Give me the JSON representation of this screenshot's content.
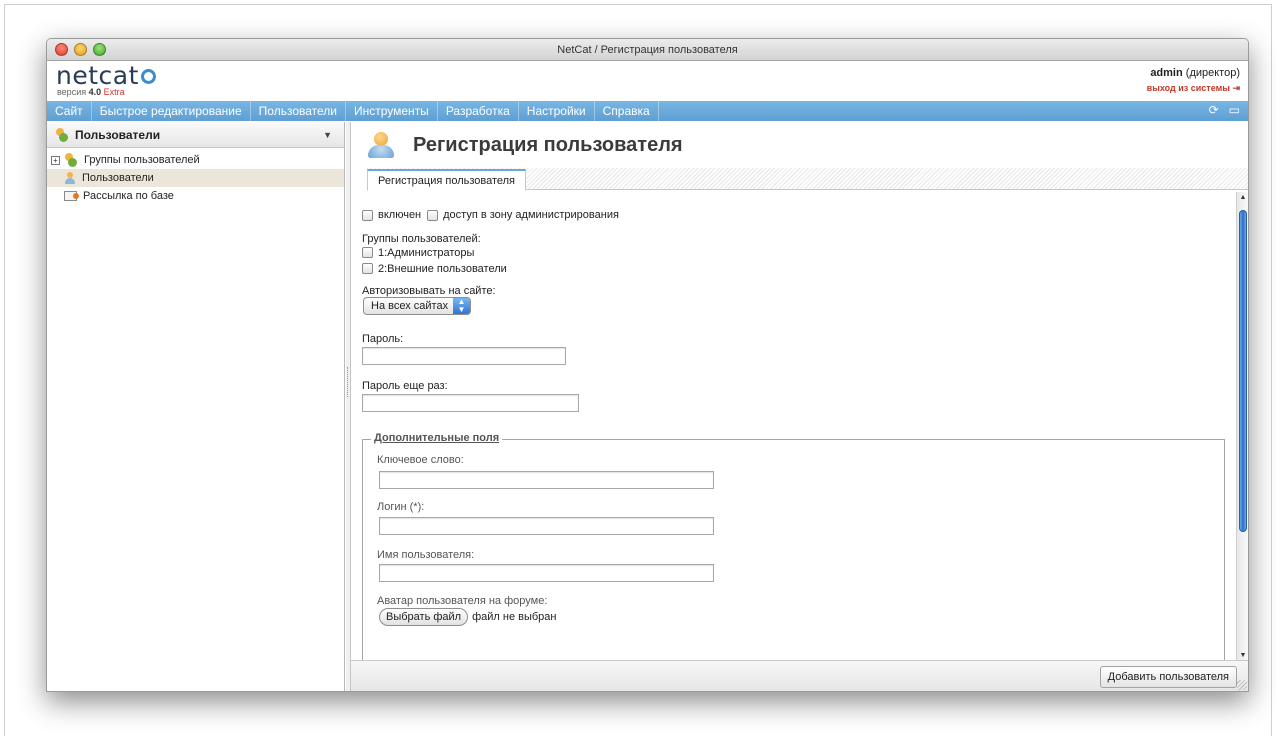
{
  "window": {
    "title": "NetCat / Регистрация пользователя"
  },
  "header": {
    "logo_text": "netcat",
    "version_prefix": "версия",
    "version_number": "4.0",
    "version_edition": "Extra",
    "user_name": "admin",
    "user_role": "(директор)",
    "logout_label": "выход из системы"
  },
  "menu": {
    "items": [
      "Сайт",
      "Быстрое редактирование",
      "Пользователи",
      "Инструменты",
      "Разработка",
      "Настройки",
      "Справка"
    ]
  },
  "sidebar": {
    "title": "Пользователи",
    "items": [
      {
        "label": "Группы пользователей"
      },
      {
        "label": "Пользователи"
      },
      {
        "label": "Рассылка по базе"
      }
    ]
  },
  "main": {
    "title": "Регистрация пользователя",
    "tab_label": "Регистрация пользователя",
    "enabled_label": "включен",
    "admin_access_label": "доступ в зону администрирования",
    "groups_label": "Группы пользователей:",
    "groups": [
      "1:Администраторы",
      "2:Внешние пользователи"
    ],
    "authorize_label": "Авторизовывать на сайте:",
    "authorize_value": "На всех сайтах",
    "password_label": "Пароль:",
    "password_again_label": "Пароль еще раз:",
    "extra_fields_legend": "Дополнительные поля",
    "keyword_label": "Ключевое слово:",
    "login_label": "Логин (*):",
    "username_label": "Имя пользователя:",
    "avatar_label": "Аватар пользователя на форуме:",
    "choose_file_label": "Выбрать файл",
    "no_file_label": "файл не выбран",
    "add_user_button": "Добавить пользователя"
  },
  "icons": {
    "menu_right": [
      "refresh-icon",
      "chat-icon"
    ]
  },
  "colors": {
    "menubar": "#68a9da",
    "scroll_thumb": "#2e6fcb",
    "edition": "#d4322b"
  }
}
